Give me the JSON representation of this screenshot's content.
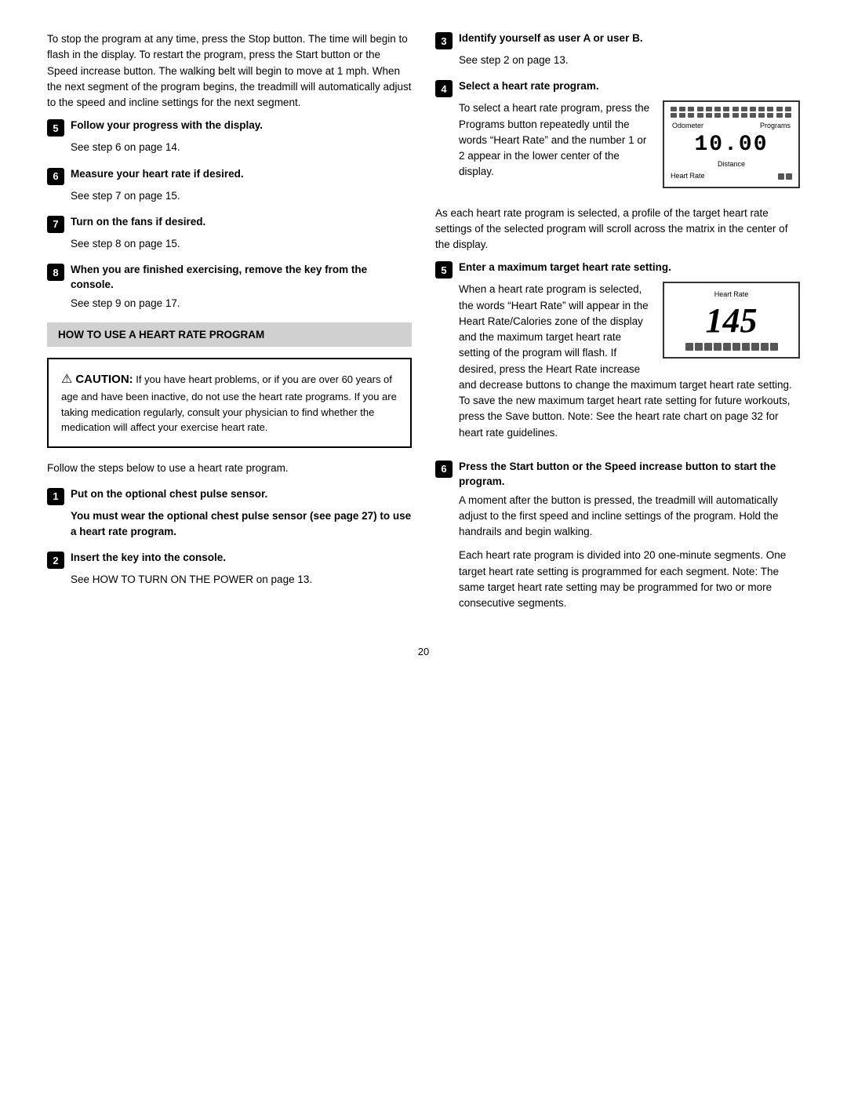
{
  "intro_paragraph": "To stop the program at any time, press the Stop button. The time will begin to flash in the display. To restart the program, press the Start button or the Speed increase button. The walking belt will begin to move at 1 mph. When the next segment of the program begins, the treadmill will automatically adjust to the speed and incline settings for the next segment.",
  "left_column": {
    "steps": [
      {
        "number": "5",
        "title": "Follow your progress with the display.",
        "body": "See step 6 on page 14."
      },
      {
        "number": "6",
        "title": "Measure your heart rate if desired.",
        "body": "See step 7 on page 15."
      },
      {
        "number": "7",
        "title": "Turn on the fans if desired.",
        "body": "See step 8 on page 15."
      },
      {
        "number": "8",
        "title": "When you are finished exercising, remove the key from the console.",
        "body": "See step 9 on page 17."
      }
    ],
    "how_to_title": "HOW TO USE A HEART RATE PROGRAM",
    "caution": {
      "title": "CAUTION:",
      "text": " If you have heart problems, or if you are over 60 years of age and have been inactive, do not use the heart rate programs. If you are taking medication regularly, consult your physician to find whether the medication will affect your exercise heart rate."
    },
    "follow_steps": "Follow the steps below to use a heart rate program.",
    "steps2": [
      {
        "number": "1",
        "title": "Put on the optional chest pulse sensor.",
        "bold_body": "You must wear the optional chest pulse sensor (see page 27) to use a heart rate program."
      },
      {
        "number": "2",
        "title": "Insert the key into the console.",
        "body": "See HOW TO TURN ON THE POWER on page 13."
      }
    ]
  },
  "right_column": {
    "steps": [
      {
        "number": "3",
        "title": "Identify yourself as user A or user B.",
        "body": "See step 2 on page 13."
      },
      {
        "number": "4",
        "title": "Select a heart rate program.",
        "body_parts": [
          "To select a heart rate program, press the Programs button repeatedly until the words “Heart Rate” and the number 1 or 2 appear in the lower center of the display."
        ],
        "display": {
          "top_labels": [
            "Odometer",
            "Programs"
          ],
          "digits": "10.00",
          "distance_label": "Distance",
          "bottom_left": "Heart Rate",
          "bars": 2
        }
      }
    ],
    "profile_para": "As each heart rate program is selected, a profile of the target heart rate settings of the selected program will scroll across the matrix in the center of the display.",
    "step5": {
      "number": "5",
      "title": "Enter a maximum target heart rate setting.",
      "body1": "When a heart rate program is selected, the words “Heart Rate” will appear in the Heart Rate/Calories zone of the display and the maximum target heart rate setting of the program will flash. If desired, press the Heart Rate increase and decrease buttons to change the maximum target heart rate setting. To save the new maximum target heart rate setting for future workouts, press the Save button. Note: See the heart rate chart on page 32 for heart rate guidelines.",
      "display2": {
        "label": "Heart Rate",
        "number": "145"
      }
    },
    "step6": {
      "number": "6",
      "title": "Press the Start button or the Speed increase button to start the program.",
      "body1": "A moment after the button is pressed, the treadmill will automatically adjust to the first speed and incline settings of the program. Hold the handrails and begin walking.",
      "body2": "Each heart rate program is divided into 20 one-minute segments. One target heart rate setting is programmed for each segment. Note: The same target heart rate setting may be programmed for two or more consecutive segments."
    }
  },
  "page_number": "20"
}
